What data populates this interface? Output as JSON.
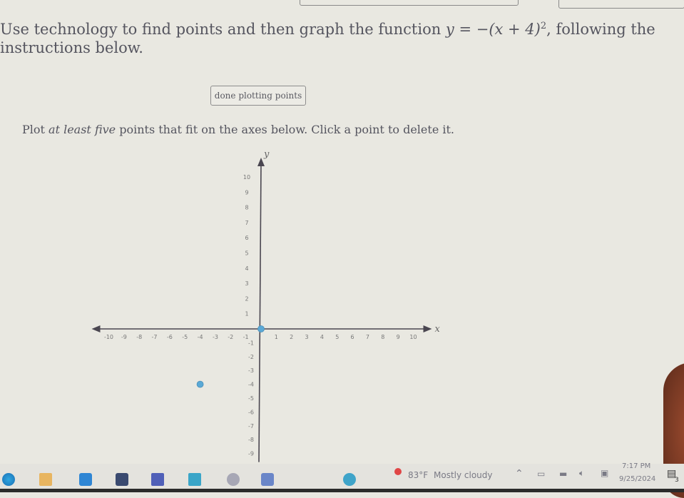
{
  "question": {
    "prefix": "Use technology to find points and then graph the function ",
    "function_display": "y = −(x + 4)",
    "exponent": "2",
    "suffix": ", following the instructions below."
  },
  "button": {
    "done_label": "done plotting points"
  },
  "instructions": {
    "text_before": "Plot ",
    "emphasis": "at least five",
    "text_after": " points that fit on the axes below. Click a point to delete it."
  },
  "graph": {
    "x_label": "x",
    "y_label": "y",
    "x_ticks": [
      -10,
      -9,
      -8,
      -7,
      -6,
      -5,
      -4,
      -3,
      -2,
      -1,
      1,
      2,
      3,
      4,
      5,
      6,
      7,
      8,
      9,
      10
    ],
    "y_ticks_positive": [
      1,
      2,
      3,
      4,
      5,
      6,
      7,
      8,
      9,
      10
    ],
    "y_ticks_negative": [
      -1,
      -2,
      -3,
      -4,
      -5,
      -6,
      -7,
      -8,
      -9
    ],
    "x_range": [
      -10,
      10
    ],
    "y_range": [
      -9,
      10
    ],
    "plotted_points": [
      {
        "x": 0,
        "y": 0
      },
      {
        "x": -4,
        "y": -4
      }
    ],
    "point_color": "#5aa9d6",
    "axis_color": "#4a4650"
  },
  "taskbar": {
    "apps": [
      "edge-icon",
      "file-explorer-icon",
      "store-icon",
      "dropbox-icon",
      "app-s-icon",
      "mail-icon",
      "globe-icon",
      "teams-icon",
      "help-icon"
    ],
    "weather_temp": "83°F",
    "weather_desc": "Mostly cloudy",
    "time": "7:17 PM",
    "date": "9/25/2024",
    "notification_count": "3"
  }
}
